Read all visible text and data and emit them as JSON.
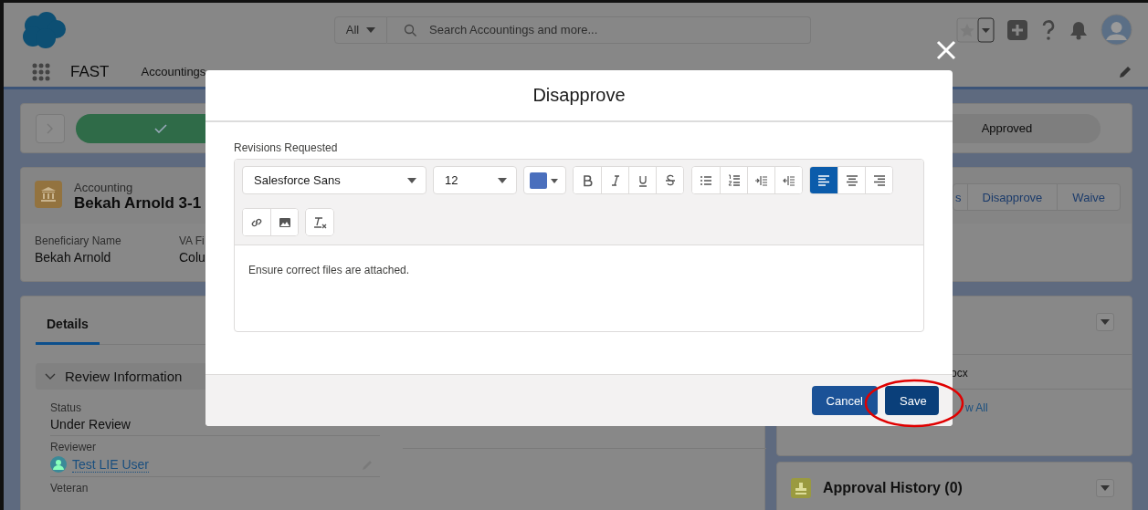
{
  "header": {
    "search_scope": "All",
    "search_placeholder": "Search Accountings and more...",
    "app_name": "FAST",
    "nav_items": [
      "Accountings"
    ]
  },
  "path": {
    "steps": [
      {
        "kind": "complete"
      },
      {
        "kind": "pending",
        "label": "Approved"
      }
    ]
  },
  "record": {
    "object_type": "Accounting",
    "title": "Bekah Arnold 3-1",
    "actions": [
      "s",
      "Disapprove",
      "Waive"
    ],
    "fields": [
      {
        "label": "Beneficiary Name",
        "value": "Bekah Arnold"
      },
      {
        "label": "VA Fi",
        "value": "Colu"
      }
    ]
  },
  "details": {
    "tabs": [
      {
        "label": "Details",
        "selected": true
      }
    ],
    "section": {
      "title": "Review Information",
      "expanded": true
    },
    "fields": [
      {
        "kind": "text",
        "label": "Status",
        "value": "Under Review"
      },
      {
        "kind": "user",
        "label": "Reviewer",
        "value": "Test LIE User"
      },
      {
        "kind": "text",
        "label": "Veteran"
      }
    ]
  },
  "files": {
    "items": [
      "ocx"
    ],
    "link": "w All"
  },
  "approval_history": {
    "title": "Approval History (0)"
  },
  "modal": {
    "title": "Disapprove",
    "field_label": "Revisions Requested",
    "font": "Salesforce Sans",
    "size": "12",
    "text": "Ensure correct files are attached.",
    "align_buttons": [
      {
        "kind": "left",
        "selected": true
      },
      {
        "kind": "center",
        "selected": false
      },
      {
        "kind": "right",
        "selected": false
      }
    ],
    "buttons": [
      {
        "kind": "neutral",
        "label": "Cancel",
        "circled": false
      },
      {
        "kind": "brand",
        "label": "Save",
        "circled": true
      }
    ]
  }
}
